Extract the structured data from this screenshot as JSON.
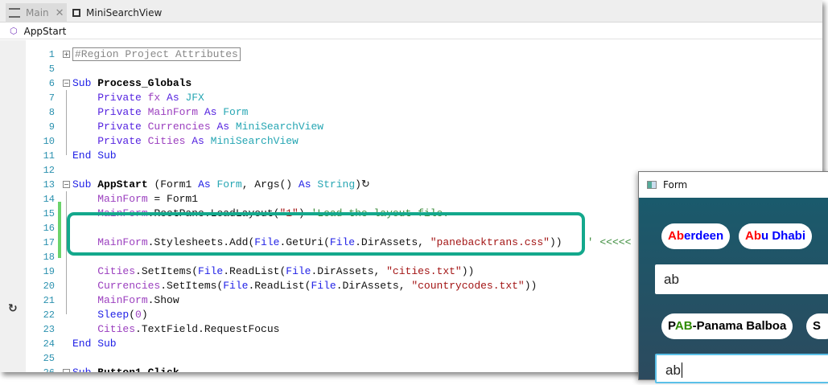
{
  "tabs": [
    {
      "label": "Main",
      "icon": "designer-icon",
      "active": false
    },
    {
      "label": "MiniSearchView",
      "icon": "class-module-icon",
      "active": true
    }
  ],
  "breadcrumb": {
    "label": "AppStart",
    "icon": "cube-icon"
  },
  "colors": {
    "highlight": "#13a88c",
    "form_bg": "#1a5a6c",
    "match": "#ff0000",
    "rest": "#0000ff",
    "currency_match": "#2e8b00"
  },
  "code": [
    {
      "n": "1",
      "fold": "+",
      "t": [
        [
          "#Region Project Attributes",
          "reg"
        ]
      ]
    },
    {
      "n": "5",
      "t": []
    },
    {
      "n": "6",
      "fold": "-",
      "t": [
        [
          "Sub ",
          "kw"
        ],
        [
          "Process_Globals",
          "b"
        ]
      ]
    },
    {
      "n": "7",
      "t": [
        [
          "    Private ",
          "pv"
        ],
        [
          "fx ",
          "var"
        ],
        [
          "As ",
          "pv"
        ],
        [
          "JFX",
          "type"
        ]
      ]
    },
    {
      "n": "8",
      "t": [
        [
          "    Private ",
          "pv"
        ],
        [
          "MainForm ",
          "var"
        ],
        [
          "As ",
          "pv"
        ],
        [
          "Form",
          "type"
        ]
      ]
    },
    {
      "n": "9",
      "t": [
        [
          "    Private ",
          "pv"
        ],
        [
          "Currencies ",
          "var"
        ],
        [
          "As ",
          "pv"
        ],
        [
          "MiniSearchView",
          "type"
        ]
      ]
    },
    {
      "n": "10",
      "t": [
        [
          "    Private ",
          "pv"
        ],
        [
          "Cities ",
          "var"
        ],
        [
          "As ",
          "pv"
        ],
        [
          "MiniSearchView",
          "type"
        ]
      ]
    },
    {
      "n": "11",
      "t": [
        [
          "End Sub",
          "kw"
        ]
      ]
    },
    {
      "n": "12",
      "t": []
    },
    {
      "n": "13",
      "fold": "-",
      "t": [
        [
          "Sub ",
          "kw"
        ],
        [
          "AppStart",
          "b"
        ],
        [
          " (Form1 ",
          "pl"
        ],
        [
          "As ",
          "kw"
        ],
        [
          "Form",
          "type"
        ],
        [
          ", Args() ",
          "pl"
        ],
        [
          "As ",
          "kw"
        ],
        [
          "String",
          "type"
        ],
        [
          ")↻",
          "pl"
        ]
      ]
    },
    {
      "n": "14",
      "t": [
        [
          "    MainForm",
          "var"
        ],
        [
          " = Form1",
          "pl"
        ]
      ]
    },
    {
      "n": "15",
      "t": [
        [
          "    MainForm",
          "var"
        ],
        [
          ".RootPane.LoadLayout(",
          "pl"
        ],
        [
          "\"1\"",
          "str"
        ],
        [
          ") ",
          "pl"
        ],
        [
          "'Load the layout file.",
          "cm"
        ]
      ]
    },
    {
      "n": "16",
      "t": []
    },
    {
      "n": "17",
      "t": [
        [
          "    MainForm",
          "var"
        ],
        [
          ".Stylesheets.Add(",
          "pl"
        ],
        [
          "File",
          "kw"
        ],
        [
          ".GetUri(",
          "pl"
        ],
        [
          "File",
          "kw"
        ],
        [
          ".DirAssets, ",
          "pl"
        ],
        [
          "\"panebacktrans.css\"",
          "str"
        ],
        [
          "))    ",
          "pl"
        ],
        [
          "' <<<<<",
          "cm"
        ]
      ]
    },
    {
      "n": "18",
      "t": []
    },
    {
      "n": "19",
      "t": [
        [
          "    Cities",
          "var"
        ],
        [
          ".SetItems(",
          "pl"
        ],
        [
          "File",
          "kw"
        ],
        [
          ".ReadList(",
          "pl"
        ],
        [
          "File",
          "kw"
        ],
        [
          ".DirAssets, ",
          "pl"
        ],
        [
          "\"cities.txt\"",
          "str"
        ],
        [
          "))",
          "pl"
        ]
      ]
    },
    {
      "n": "20",
      "t": [
        [
          "    Currencies",
          "var"
        ],
        [
          ".SetItems(",
          "pl"
        ],
        [
          "File",
          "kw"
        ],
        [
          ".ReadList(",
          "pl"
        ],
        [
          "File",
          "kw"
        ],
        [
          ".DirAssets, ",
          "pl"
        ],
        [
          "\"countrycodes.txt\"",
          "str"
        ],
        [
          "))",
          "pl"
        ]
      ]
    },
    {
      "n": "21",
      "t": [
        [
          "    MainForm",
          "var"
        ],
        [
          ".Show",
          "pl"
        ]
      ]
    },
    {
      "n": "22",
      "t": [
        [
          "    Sleep",
          "kw"
        ],
        [
          "(",
          "pl"
        ],
        [
          "0",
          "var"
        ],
        [
          ")",
          "pl"
        ]
      ]
    },
    {
      "n": "23",
      "t": [
        [
          "    Cities",
          "var"
        ],
        [
          ".TextField.RequestFocus",
          "pl"
        ]
      ]
    },
    {
      "n": "24",
      "t": [
        [
          "End Sub",
          "kw"
        ]
      ]
    },
    {
      "n": "25",
      "t": []
    },
    {
      "n": "26",
      "fold": "-",
      "t": [
        [
          "Sub ",
          "kw"
        ],
        [
          "Button1_Click",
          "b"
        ]
      ]
    }
  ],
  "form": {
    "title": "Form",
    "city_chips": [
      {
        "match": "Ab",
        "rest": "erdeen"
      },
      {
        "match": "Ab",
        "rest": "u Dhabi"
      }
    ],
    "city_input": "ab",
    "currency_chips": [
      {
        "pre": "P",
        "match": "AB",
        "rest": "-Panama Balboa"
      },
      {
        "pre": "S",
        "match": "",
        "rest": ""
      }
    ],
    "currency_input": "ab"
  }
}
